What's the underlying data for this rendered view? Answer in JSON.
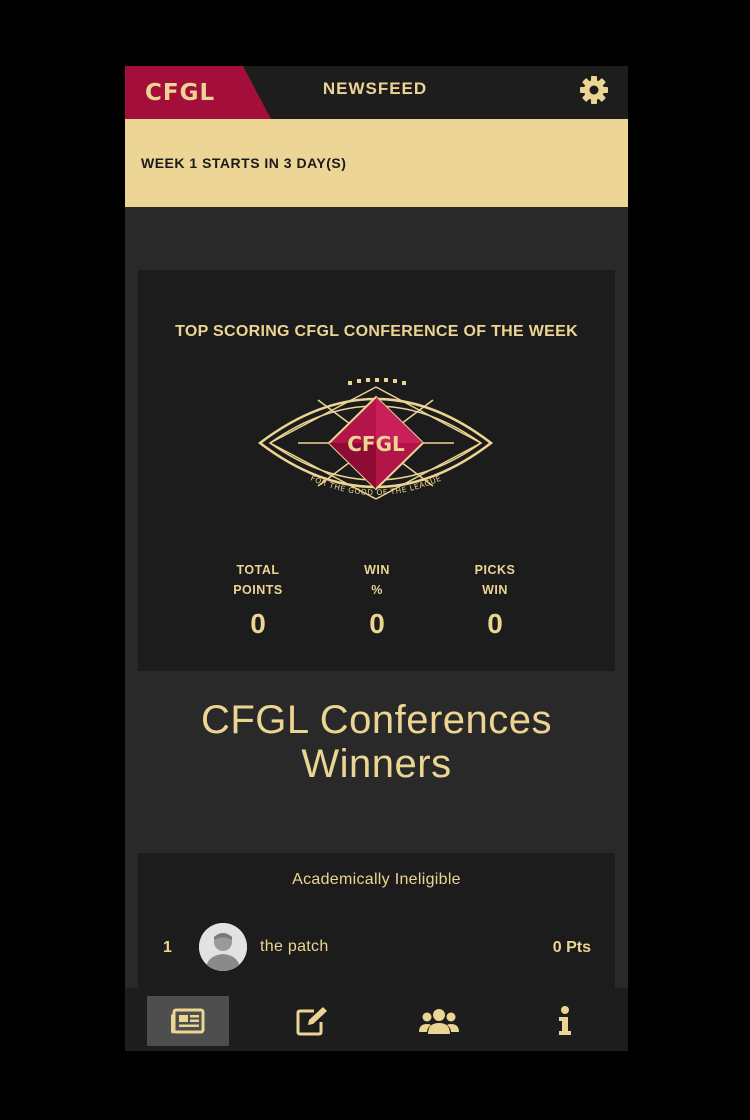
{
  "header": {
    "logo_text": "CFGL",
    "title": "NEWSFEED",
    "settings_icon": "gear-icon"
  },
  "banner": {
    "text": "WEEK 1 STARTS IN 3 DAY(S)"
  },
  "top_conference": {
    "title": "TOP SCORING CFGL CONFERENCE OF THE WEEK",
    "emblem_text": "CFGL",
    "emblem_tagline": "FOR THE GOOD OF THE LEAGUE",
    "stats": [
      {
        "label": "TOTAL\nPOINTS",
        "value": "0"
      },
      {
        "label": "WIN\n%",
        "value": "0"
      },
      {
        "label": "PICKS\nWIN",
        "value": "0"
      }
    ]
  },
  "winners": {
    "title": "CFGL Conferences Winners",
    "conference": {
      "name": "Academically Ineligible",
      "entries": [
        {
          "rank": "1",
          "name": "the patch",
          "points": "0 Pts"
        }
      ]
    }
  },
  "bottom_nav": {
    "items": [
      {
        "icon": "newspaper-icon",
        "active": true
      },
      {
        "icon": "edit-icon",
        "active": false
      },
      {
        "icon": "users-icon",
        "active": false
      },
      {
        "icon": "info-icon",
        "active": false
      }
    ]
  },
  "colors": {
    "gold": "#ecd592",
    "crimson": "#a30f3a",
    "banner": "#ecd595",
    "background": "#292929",
    "card": "#1c1c1c"
  }
}
